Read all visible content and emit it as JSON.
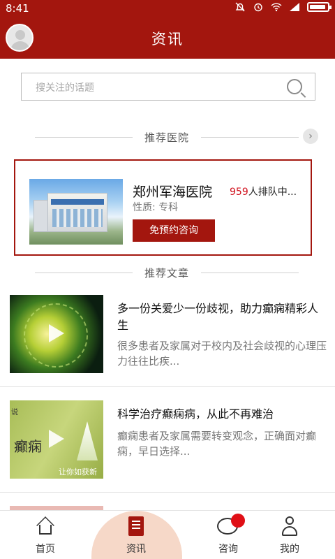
{
  "status_bar": {
    "time": "8:41"
  },
  "header": {
    "title": "资讯"
  },
  "search": {
    "placeholder": "搜关注的话题"
  },
  "recommended_hospitals": {
    "section_title": "推荐医院",
    "hospital": {
      "name": "郑州军海医院",
      "queue_count": "959",
      "queue_suffix": "人排队中...",
      "type": "性质: 专科",
      "consult_button": "免预约咨询"
    }
  },
  "recommended_articles": {
    "section_title": "推荐文章",
    "items": [
      {
        "title": "多一份关爱少一份歧视，助力癫痫精彩人生",
        "description": "很多患者及家属对于校内及社会歧视的心理压力往往比疾..."
      },
      {
        "title": "科学治疗癫痫病，从此不再难治",
        "description": "癫痫患者及家属需要转变观念，正确面对癫痫，早日选择...",
        "thumb_word": "癫痫",
        "thumb_slogan": "让你如获新",
        "thumb_small": "说"
      }
    ]
  },
  "bottom_nav": {
    "items": [
      {
        "label": "首页",
        "icon": "home-icon"
      },
      {
        "label": "资讯",
        "icon": "news-book-icon",
        "active": true
      },
      {
        "label": "咨询",
        "icon": "chat-icon"
      },
      {
        "label": "我的",
        "icon": "user-icon"
      }
    ]
  },
  "colors": {
    "brand": "#a3160e",
    "accent_red": "#d0101c",
    "nav_highlight": "#f6d8c8"
  }
}
